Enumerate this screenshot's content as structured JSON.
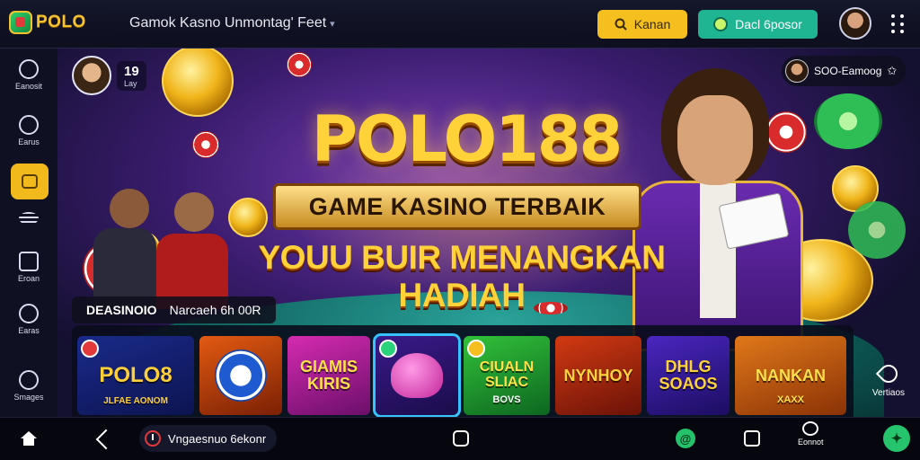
{
  "header": {
    "logo_text": "POLO",
    "title": "Gamok Kasno Unmontag' Feet",
    "search_label": "Kanan",
    "deposit_label": "Dacl 6posor"
  },
  "sidebar": {
    "items": [
      {
        "label": "Eanosit"
      },
      {
        "label": "Earus"
      },
      {
        "label": ""
      },
      {
        "label": "Eroan"
      },
      {
        "label": "Earas"
      },
      {
        "label": "Smages"
      }
    ]
  },
  "hero": {
    "user_value": "19",
    "user_sub": "Lay",
    "title": "POLO188",
    "ribbon": "GAME KASINO TERBAIK",
    "slogan": "YOUU BUIR MENANGKAN HADIAH",
    "promo": "SOO-Eamoog"
  },
  "games_section": {
    "label_a": "DEASINOIO",
    "label_b": "Narcaeh 6h 00R",
    "items": [
      {
        "label": "POLO8",
        "sub": "JLFAE AONOM",
        "color_a": "#1a2a8a",
        "color_b": "#0c1450"
      },
      {
        "label": "",
        "sub": "",
        "color_a": "#e25a12",
        "color_b": "#7a2004"
      },
      {
        "label": "GIAMIS KIRIS",
        "sub": "",
        "color_a": "#d52bb0",
        "color_b": "#6b0f6a"
      },
      {
        "label": "",
        "sub": "",
        "color_a": "#3a1a8a",
        "color_b": "#1b0c4a"
      },
      {
        "label": "CIUALN SLIAC",
        "sub": "BOVS",
        "color_a": "#32c23a",
        "color_b": "#0d6620"
      },
      {
        "label": "NYNHOY",
        "sub": "",
        "color_a": "#d23a12",
        "color_b": "#6a1208"
      },
      {
        "label": "DHLG SOAOS",
        "sub": "",
        "color_a": "#4a26c0",
        "color_b": "#1c0d60"
      },
      {
        "label": "NANKAN",
        "sub": "XAXX",
        "color_a": "#e0781a",
        "color_b": "#8a3206"
      }
    ],
    "right_label": "Vertiaos"
  },
  "bottom_nav": {
    "record_label": "Vngaesnuo 6ekonr",
    "chat_label": "Eonnot"
  },
  "colors": {
    "accent_yellow": "#f4bf1f",
    "accent_teal": "#1fb592",
    "bg": "#0b0d1a"
  }
}
